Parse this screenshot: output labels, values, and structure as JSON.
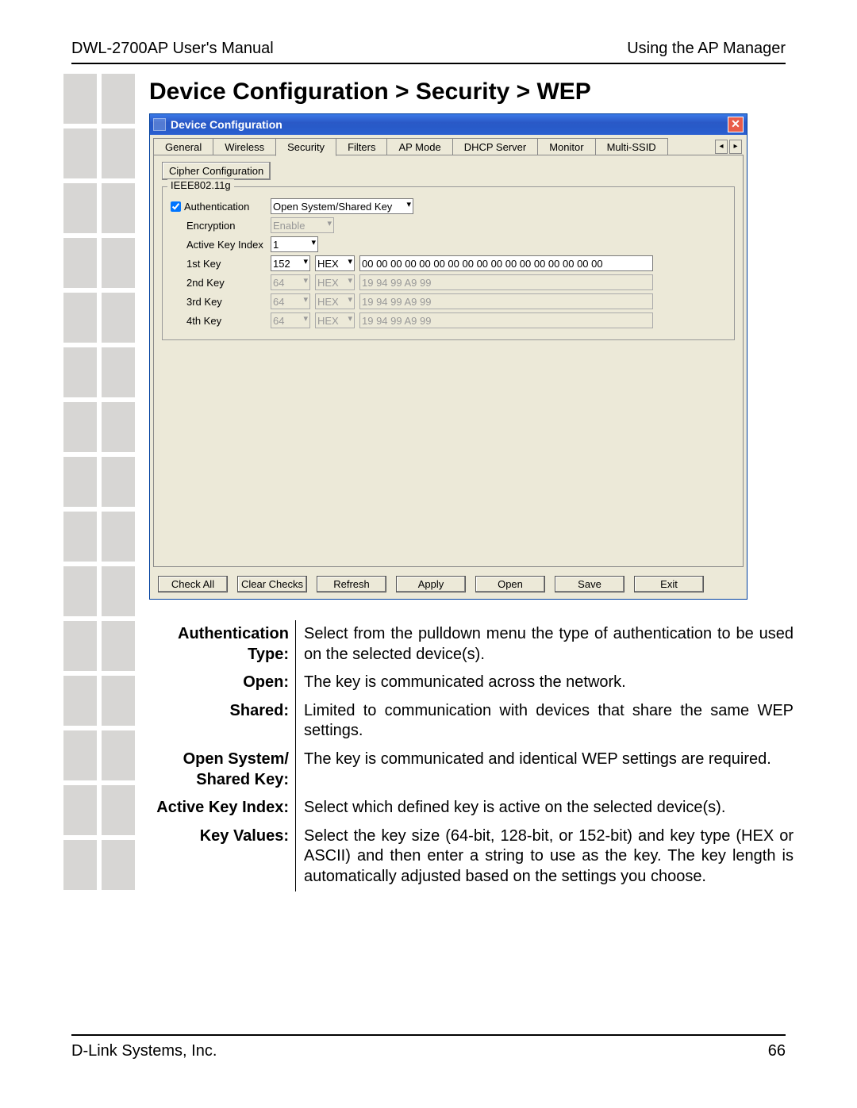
{
  "header": {
    "left": "DWL-2700AP User's Manual",
    "right": "Using the AP Manager"
  },
  "page_title": "Device Configuration > Security > WEP",
  "window": {
    "title": "Device Configuration",
    "tabs": [
      "General",
      "Wireless",
      "Security",
      "Filters",
      "AP Mode",
      "DHCP Server",
      "Monitor",
      "Multi-SSID"
    ],
    "active_tab_index": 2,
    "cipher_button": "Cipher Configuration",
    "fieldset_legend": "IEEE802.11g",
    "labels": {
      "authentication": "Authentication",
      "encryption": "Encryption",
      "active_key_index": "Active Key Index",
      "keys": [
        "1st Key",
        "2nd Key",
        "3rd Key",
        "4th Key"
      ]
    },
    "authentication_checked": true,
    "authentication_value": "Open System/Shared Key",
    "encryption_value": "Enable",
    "encryption_disabled": true,
    "active_key_index_value": "1",
    "key_rows": [
      {
        "size": "152",
        "type": "HEX",
        "value": "00 00 00 00 00 00 00 00 00 00 00 00 00 00 00 00 00",
        "enabled": true
      },
      {
        "size": "64",
        "type": "HEX",
        "value": "19 94 99 A9 99",
        "enabled": false
      },
      {
        "size": "64",
        "type": "HEX",
        "value": "19 94 99 A9 99",
        "enabled": false
      },
      {
        "size": "64",
        "type": "HEX",
        "value": "19 94 99 A9 99",
        "enabled": false
      }
    ],
    "buttons": [
      "Check All",
      "Clear Checks",
      "Refresh",
      "Apply",
      "Open",
      "Save",
      "Exit"
    ]
  },
  "descriptions": [
    {
      "term": "Authentication Type:",
      "def": "Select from the pulldown menu the type of authentication to be used on the selected device(s)."
    },
    {
      "term": "Open:",
      "def": "The key is communicated across the network."
    },
    {
      "term": "Shared:",
      "def": "Limited to communication with devices that share the same WEP settings."
    },
    {
      "term": "Open System/ Shared Key:",
      "def": "The key is communicated and identical WEP settings are required."
    },
    {
      "term": "Active Key Index:",
      "def": "Select which defined key is active on the selected device(s)."
    },
    {
      "term": "Key Values:",
      "def": "Select the key size (64-bit, 128-bit, or 152-bit) and key type (HEX or ASCII) and then enter a string to use as the key. The key length is automatically adjusted based on the settings you choose."
    }
  ],
  "footer": {
    "left": "D-Link Systems, Inc.",
    "right": "66"
  }
}
